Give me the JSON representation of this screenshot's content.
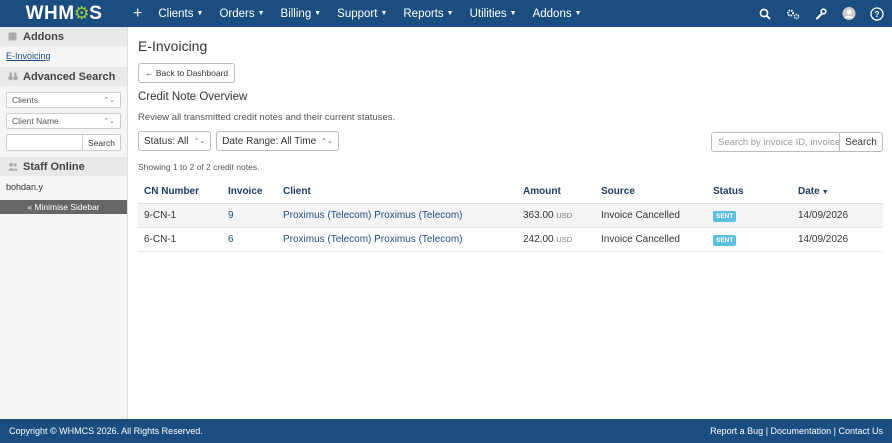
{
  "brand": {
    "logo_pre": "WHM",
    "logo_post": "S",
    "accent": "#9bc93f",
    "nav_bg": "#1a4d80"
  },
  "nav": {
    "plus": "+",
    "items": [
      "Clients",
      "Orders",
      "Billing",
      "Support",
      "Reports",
      "Utilities",
      "Addons"
    ]
  },
  "sidebar": {
    "addons_heading": "Addons",
    "addons_link": "E-Invoicing",
    "advanced_search_heading": "Advanced Search",
    "search_type": "Clients",
    "search_field": "Client Name",
    "search_button": "Search",
    "staff_heading": "Staff Online",
    "staff_user": "bohdan.y",
    "minimise": "« Minimise Sidebar"
  },
  "main": {
    "title": "E-Invoicing",
    "back_button": "← Back to Dashboard",
    "subtitle": "Credit Note Overview",
    "description": "Review all transmitted credit notes and their current statuses.",
    "filter_status": "Status: All",
    "filter_date": "Date Range: All Time",
    "search_placeholder": "Search by invoice ID, invoice",
    "search_button": "Search",
    "showing": "Showing 1 to 2 of 2 credit notes."
  },
  "table": {
    "headers": [
      "CN Number",
      "Invoice",
      "Client",
      "Amount",
      "Source",
      "Status",
      "Date"
    ],
    "rows": [
      {
        "cn": "9-CN-1",
        "invoice": "9",
        "client": "Proximus (Telecom) Proximus (Telecom)",
        "amount": "363.00",
        "currency": "USD",
        "source": "Invoice Cancelled",
        "status": "SENT",
        "date": "14/09/2026"
      },
      {
        "cn": "6-CN-1",
        "invoice": "6",
        "client": "Proximus (Telecom) Proximus (Telecom)",
        "amount": "242.00",
        "currency": "USD",
        "source": "Invoice Cancelled",
        "status": "SENT",
        "date": "14/09/2026"
      }
    ]
  },
  "footer": {
    "copyright": "Copyright © WHMCS 2026. All Rights Reserved.",
    "report_bug": "Report a Bug",
    "documentation": "Documentation",
    "contact": "Contact Us",
    "sep": "|"
  }
}
